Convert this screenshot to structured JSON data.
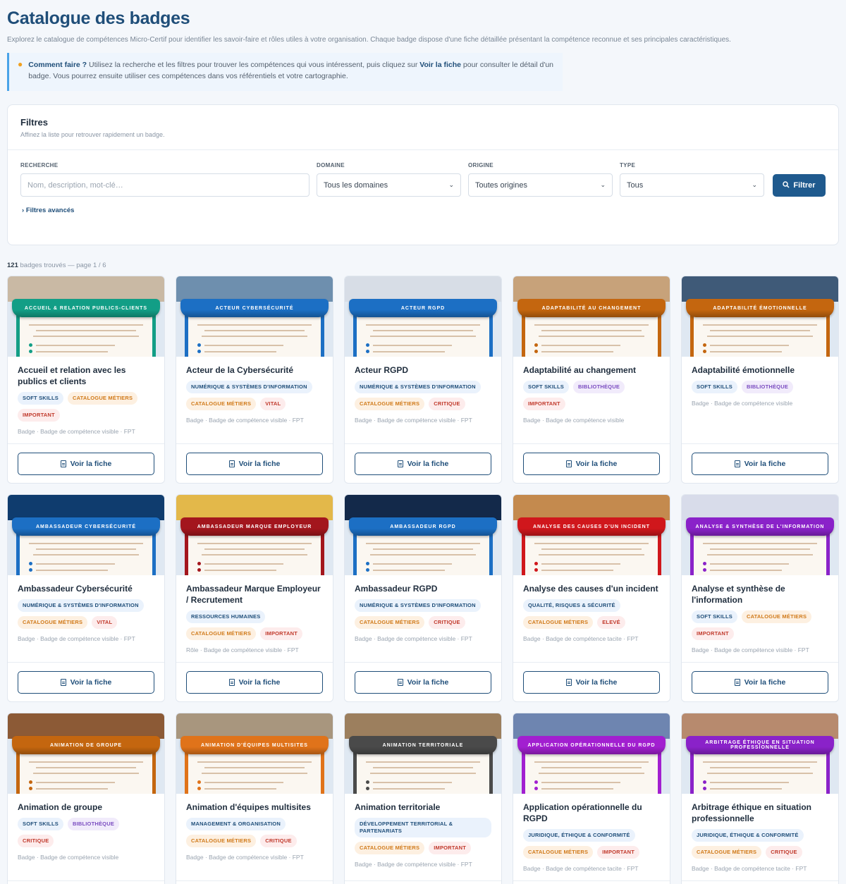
{
  "page": {
    "title": "Catalogue des badges",
    "intro": "Explorez le catalogue de compétences Micro-Certif pour identifier les savoir-faire et rôles utiles à votre organisation. Chaque badge dispose d'une fiche détaillée présentant la compétence reconnue et ses principales caractéristiques.",
    "howto_lead": "Comment faire ?",
    "howto_text_1": " Utilisez la recherche et les filtres pour trouver les compétences qui vous intéressent, puis cliquez sur ",
    "howto_link": "Voir la fiche",
    "howto_text_2": " pour consulter le détail d'un badge. Vous pourrez ensuite utiliser ces compétences dans vos référentiels et votre cartographie."
  },
  "filters": {
    "title": "Filtres",
    "subtitle": "Affinez la liste pour retrouver rapidement un badge.",
    "search_label": "RECHERCHE",
    "search_placeholder": "Nom, description, mot-clé…",
    "domain_label": "DOMAINE",
    "domain_value": "Tous les domaines",
    "origin_label": "ORIGINE",
    "origin_value": "Toutes origines",
    "type_label": "TYPE",
    "type_value": "Tous",
    "filter_button": "Filtrer",
    "advanced": "Filtres avancés"
  },
  "results": {
    "count": "121",
    "text": " badges trouvés — page 1 / 6"
  },
  "view_label": "Voir la fiche",
  "colors": {
    "primary": "#1f4e79",
    "accent": "#4aa3e8"
  },
  "cards": [
    {
      "banner": "ACCUEIL & RELATION PUBLICS-CLIENTS",
      "color": "#129e86",
      "photo": "#c9b9a4",
      "name": "Accueil et relation avec les publics et clients",
      "tags": [
        {
          "t": "Soft skills",
          "k": "domain"
        },
        {
          "t": "Catalogue métiers",
          "k": "cat"
        },
        {
          "t": "Important",
          "k": "pri"
        }
      ],
      "meta": "Badge · Badge de compétence visible · FPT"
    },
    {
      "banner": "ACTEUR CYBERSÉCURITÉ",
      "color": "#1c6fc4",
      "photo": "#6e8fae",
      "name": "Acteur de la Cybersécurité",
      "tags": [
        {
          "t": "Numérique & systèmes d'information",
          "k": "domain"
        },
        {
          "t": "Catalogue métiers",
          "k": "cat"
        },
        {
          "t": "Vital",
          "k": "pri"
        }
      ],
      "meta": "Badge · Badge de compétence visible · FPT"
    },
    {
      "banner": "ACTEUR RGPD",
      "color": "#1c6fc4",
      "photo": "#d7dde6",
      "name": "Acteur RGPD",
      "tags": [
        {
          "t": "Numérique & systèmes d'information",
          "k": "domain"
        },
        {
          "t": "Catalogue métiers",
          "k": "cat"
        },
        {
          "t": "Critique",
          "k": "pri"
        }
      ],
      "meta": "Badge · Badge de compétence visible · FPT"
    },
    {
      "banner": "ADAPTABILITÉ AU CHANGEMENT",
      "color": "#c4660f",
      "photo": "#c7a27a",
      "name": "Adaptabilité au changement",
      "tags": [
        {
          "t": "Soft skills",
          "k": "domain"
        },
        {
          "t": "Bibliothèque",
          "k": "bib"
        },
        {
          "t": "Important",
          "k": "pri"
        }
      ],
      "meta": "Badge · Badge de compétence visible"
    },
    {
      "banner": "ADAPTABILITÉ ÉMOTIONNELLE",
      "color": "#c4660f",
      "photo": "#3f5a78",
      "name": "Adaptabilité émotionnelle",
      "tags": [
        {
          "t": "Soft skills",
          "k": "domain"
        },
        {
          "t": "Bibliothèque",
          "k": "bib"
        }
      ],
      "meta": "Badge · Badge de compétence visible"
    },
    {
      "banner": "AMBASSADEUR CYBERSÉCURITÉ",
      "color": "#1c6fc4",
      "photo": "#0f3c6e",
      "name": "Ambassadeur Cybersécurité",
      "tags": [
        {
          "t": "Numérique & systèmes d'information",
          "k": "domain"
        },
        {
          "t": "Catalogue métiers",
          "k": "cat"
        },
        {
          "t": "Vital",
          "k": "pri"
        }
      ],
      "meta": "Badge · Badge de compétence visible · FPT"
    },
    {
      "banner": "AMBASSADEUR MARQUE EMPLOYEUR",
      "color": "#a3161d",
      "photo": "#e3b84a",
      "name": "Ambassadeur Marque Employeur / Recrutement",
      "tags": [
        {
          "t": "Ressources humaines",
          "k": "domain"
        },
        {
          "t": "Catalogue métiers",
          "k": "cat"
        },
        {
          "t": "Important",
          "k": "pri"
        }
      ],
      "meta": "Rôle · Badge de compétence visible · FPT"
    },
    {
      "banner": "AMBASSADEUR RGPD",
      "color": "#1c6fc4",
      "photo": "#13294a",
      "name": "Ambassadeur RGPD",
      "tags": [
        {
          "t": "Numérique & systèmes d'information",
          "k": "domain"
        },
        {
          "t": "Catalogue métiers",
          "k": "cat"
        },
        {
          "t": "Critique",
          "k": "pri"
        }
      ],
      "meta": "Badge · Badge de compétence visible · FPT"
    },
    {
      "banner": "ANALYSE DES CAUSES D'UN INCIDENT",
      "color": "#d0171c",
      "photo": "#c48a4e",
      "name": "Analyse des causes d'un incident",
      "tags": [
        {
          "t": "Qualité, risques & sécurité",
          "k": "domain"
        },
        {
          "t": "Catalogue métiers",
          "k": "cat"
        },
        {
          "t": "Elevé",
          "k": "pri"
        }
      ],
      "meta": "Badge · Badge de compétence tacite · FPT"
    },
    {
      "banner": "ANALYSE & SYNTHÈSE DE L'INFORMATION",
      "color": "#8a22c9",
      "photo": "#d8dcea",
      "name": "Analyse et synthèse de l'information",
      "tags": [
        {
          "t": "Soft skills",
          "k": "domain"
        },
        {
          "t": "Catalogue métiers",
          "k": "cat"
        },
        {
          "t": "Important",
          "k": "pri"
        }
      ],
      "meta": "Badge · Badge de compétence visible · FPT"
    },
    {
      "banner": "ANIMATION DE GROUPE",
      "color": "#c4660f",
      "photo": "#8c5a36",
      "name": "Animation de groupe",
      "tags": [
        {
          "t": "Soft skills",
          "k": "domain"
        },
        {
          "t": "Bibliothèque",
          "k": "bib"
        },
        {
          "t": "Critique",
          "k": "pri"
        }
      ],
      "meta": "Badge · Badge de compétence visible"
    },
    {
      "banner": "ANIMATION D'ÉQUIPES MULTISITES",
      "color": "#e0731a",
      "photo": "#a8967e",
      "name": "Animation d'équipes multisites",
      "tags": [
        {
          "t": "Management & organisation",
          "k": "domain"
        },
        {
          "t": "Catalogue métiers",
          "k": "cat"
        },
        {
          "t": "Critique",
          "k": "pri"
        }
      ],
      "meta": "Badge · Badge de compétence visible · FPT"
    },
    {
      "banner": "ANIMATION TERRITORIALE",
      "color": "#4a4a4a",
      "photo": "#9c7f5e",
      "name": "Animation territoriale",
      "tags": [
        {
          "t": "Développement territorial & partenariats",
          "k": "domain"
        },
        {
          "t": "Catalogue métiers",
          "k": "cat"
        },
        {
          "t": "Important",
          "k": "pri"
        }
      ],
      "meta": "Badge · Badge de compétence visible · FPT"
    },
    {
      "banner": "APPLICATION OPÉRATIONNELLE DU RGPD",
      "color": "#a21fd0",
      "photo": "#6e85b0",
      "name": "Application opérationnelle du RGPD",
      "tags": [
        {
          "t": "Juridique, éthique & conformité",
          "k": "domain"
        },
        {
          "t": "Catalogue métiers",
          "k": "cat"
        },
        {
          "t": "Important",
          "k": "pri"
        }
      ],
      "meta": "Badge · Badge de compétence tacite · FPT"
    },
    {
      "banner": "ARBITRAGE ÉTHIQUE EN SITUATION PROFESSIONNELLE",
      "color": "#8a22c9",
      "photo": "#b78a6e",
      "name": "Arbitrage éthique en situation professionnelle",
      "tags": [
        {
          "t": "Juridique, éthique & conformité",
          "k": "domain"
        },
        {
          "t": "Catalogue métiers",
          "k": "cat"
        },
        {
          "t": "Critique",
          "k": "pri"
        }
      ],
      "meta": "Badge · Badge de compétence tacite · FPT"
    }
  ]
}
